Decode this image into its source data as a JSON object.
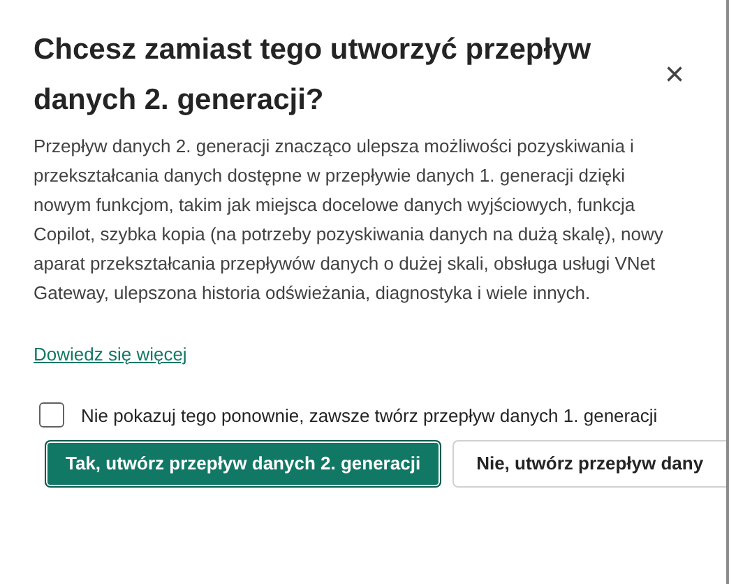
{
  "dialog": {
    "title": "Chcesz zamiast tego utworzyć przepływ danych 2. generacji?",
    "close": "×",
    "body": "Przepływ danych 2. generacji znacząco ulepsza możliwości pozyskiwania i przekształcania danych dostępne w przepływie danych 1. generacji dzięki nowym funkcjom, takim jak miejsca docelowe danych wyjściowych, funkcja Copilot, szybka kopia (na potrzeby pozyskiwania danych na dużą skalę), nowy aparat przekształcania przepływów danych o dużej skali, obsługa usługi VNet Gateway, ulepszona historia odświeżania, diagnostyka i wiele innych.",
    "link": "Dowiedz się więcej",
    "checkbox": {
      "label": "Nie pokazuj tego ponownie, zawsze twórz przepływ danych 1. generacji",
      "checked": false
    },
    "buttons": [
      {
        "label": "Tak, utwórz przepływ danych 2. generacji",
        "kind": "primary"
      },
      {
        "label": "Nie, utwórz przepływ dany",
        "kind": "secondary"
      }
    ]
  }
}
